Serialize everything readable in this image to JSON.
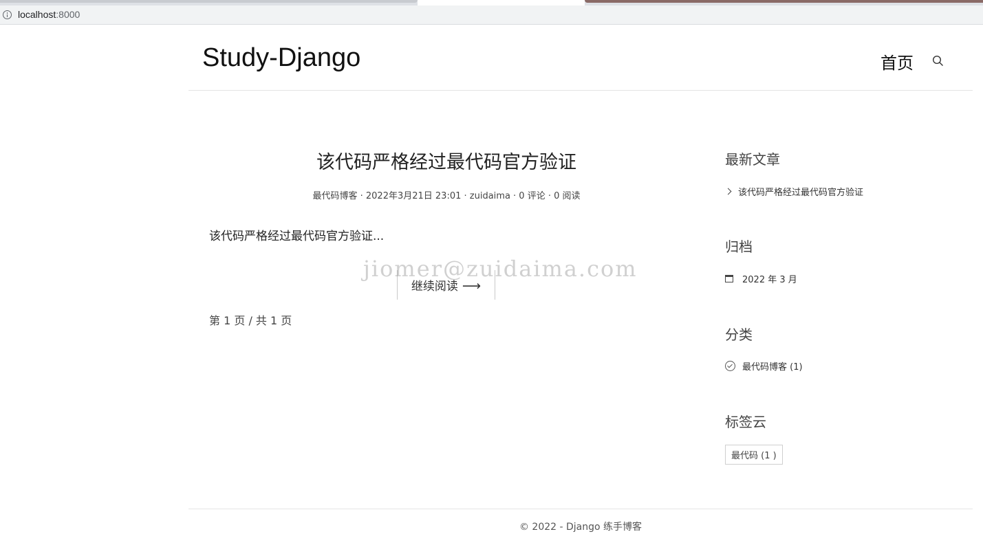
{
  "browser": {
    "url_host": "localhost",
    "url_port": ":8000"
  },
  "header": {
    "site_title": "Study-Django",
    "nav_home": "首页"
  },
  "post": {
    "title": "该代码严格经过最代码官方验证",
    "meta": "最代码博客 · 2022年3月21日 23:01 · zuidaima · 0 评论 · 0 阅读",
    "excerpt": "该代码严格经过最代码官方验证...",
    "read_more": "继续阅读",
    "read_more_arrow": "⟶"
  },
  "watermark": "jiomer@zuidaima.com",
  "pagination": "第 1 页 / 共 1 页",
  "sidebar": {
    "recent_heading": "最新文章",
    "recent_items": [
      "该代码严格经过最代码官方验证"
    ],
    "archive_heading": "归档",
    "archive_items": [
      "2022 年 3 月"
    ],
    "category_heading": "分类",
    "category_items": [
      "最代码博客 (1)"
    ],
    "tags_heading": "标签云",
    "tags": [
      "最代码 (1 )"
    ]
  },
  "footer": {
    "text": "© 2022 - Django 练手博客"
  }
}
